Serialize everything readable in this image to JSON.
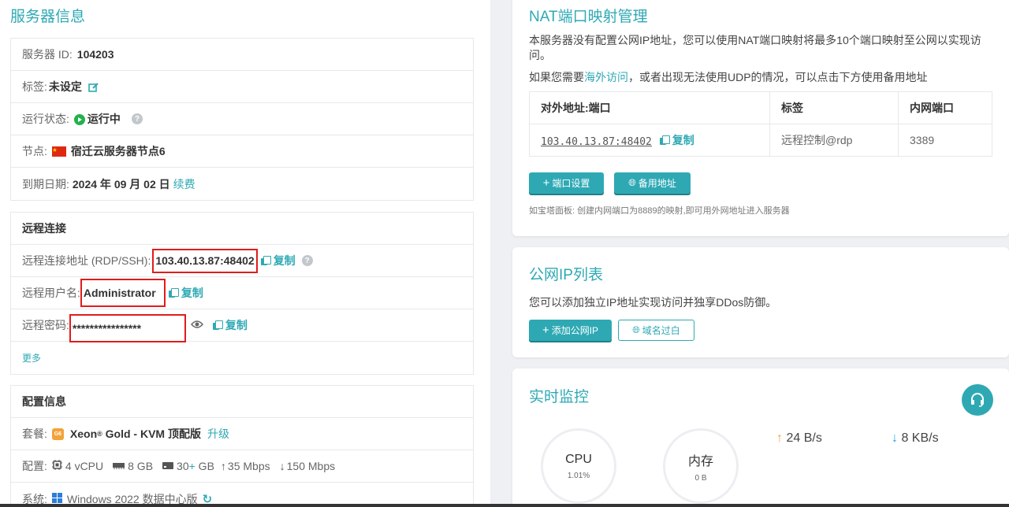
{
  "server": {
    "title": "服务器信息",
    "id_label": "服务器 ID:",
    "id_value": "104203",
    "tag_label": "标签:",
    "tag_value": "未设定",
    "status_label": "运行状态:",
    "status_value": "运行中",
    "node_label": "节点:",
    "node_value": "宿迁云服务器节点6",
    "expire_label": "到期日期:",
    "expire_value": "2024 年 09 月 02 日",
    "renew_label": "续费"
  },
  "remote": {
    "title": "远程连接",
    "addr_label": "远程连接地址 (RDP/SSH):",
    "addr_value": "103.40.13.87:48402",
    "user_label": "远程用户名:",
    "user_value": "Administrator",
    "pwd_label": "远程密码:",
    "pwd_value": "****************",
    "copy_label": "复制",
    "more_label": "更多"
  },
  "config": {
    "title": "配置信息",
    "plan_label": "套餐:",
    "plan_badge": "G6",
    "plan_brand": "Xeon",
    "plan_reg": "®",
    "plan_value": " Gold - KVM 顶配版",
    "upgrade_label": "升级",
    "spec_label": "配置:",
    "cpu": "4 vCPU",
    "ram": "8 GB",
    "disk": "30",
    "disk_plus": "+",
    "disk_unit": " GB",
    "up_bw": "35 Mbps",
    "down_bw": "150 Mbps",
    "os_label": "系统:",
    "os_value": "Windows 2022 数据中心版"
  },
  "nat": {
    "title": "NAT端口映射管理",
    "desc1": "本服务器没有配置公网IP地址，您可以使用NAT端口映射将最多10个端口映射至公网以实现访问。",
    "desc2_pre": "如果您需要",
    "desc2_link": "海外访问",
    "desc2_post": "，或者出现无法使用UDP的情况，可以点击下方使用备用地址",
    "headers": [
      "对外地址:端口",
      "标签",
      "内网端口"
    ],
    "row": {
      "addr": "103.40.13.87:48402",
      "copy": "复制",
      "tag": "远程控制@rdp",
      "port": "3389"
    },
    "btn_port": "端口设置",
    "btn_backup": "备用地址",
    "hint": "如宝塔面板: 创建内网端口为8889的映射,即可用外网地址进入服务器"
  },
  "ip": {
    "title": "公网IP列表",
    "desc": "您可以添加独立IP地址实现访问并独享DDos防御。",
    "btn_add": "添加公网IP",
    "btn_whitelist": "域名过白"
  },
  "monitor": {
    "title": "实时监控",
    "cpu_label": "CPU",
    "cpu_value": "1.01%",
    "mem_label": "内存",
    "mem_value": "0 B",
    "up": "24 B/s",
    "down": "8 KB/s"
  },
  "colors": {
    "accent": "#2ea9b4",
    "highlight": "#e01c1c",
    "running": "#22b14c",
    "up_arrow": "#f0a03c",
    "down_arrow": "#1fa3d8"
  },
  "icons": [
    "edit-icon",
    "play-circle-icon",
    "help-icon",
    "china-flag-icon",
    "copy-icon",
    "eye-icon",
    "cpu-icon",
    "memory-icon",
    "disk-icon",
    "arrow-up-icon",
    "arrow-down-icon",
    "windows-icon",
    "refresh-icon",
    "plus-icon",
    "globe-icon",
    "headset-icon"
  ]
}
